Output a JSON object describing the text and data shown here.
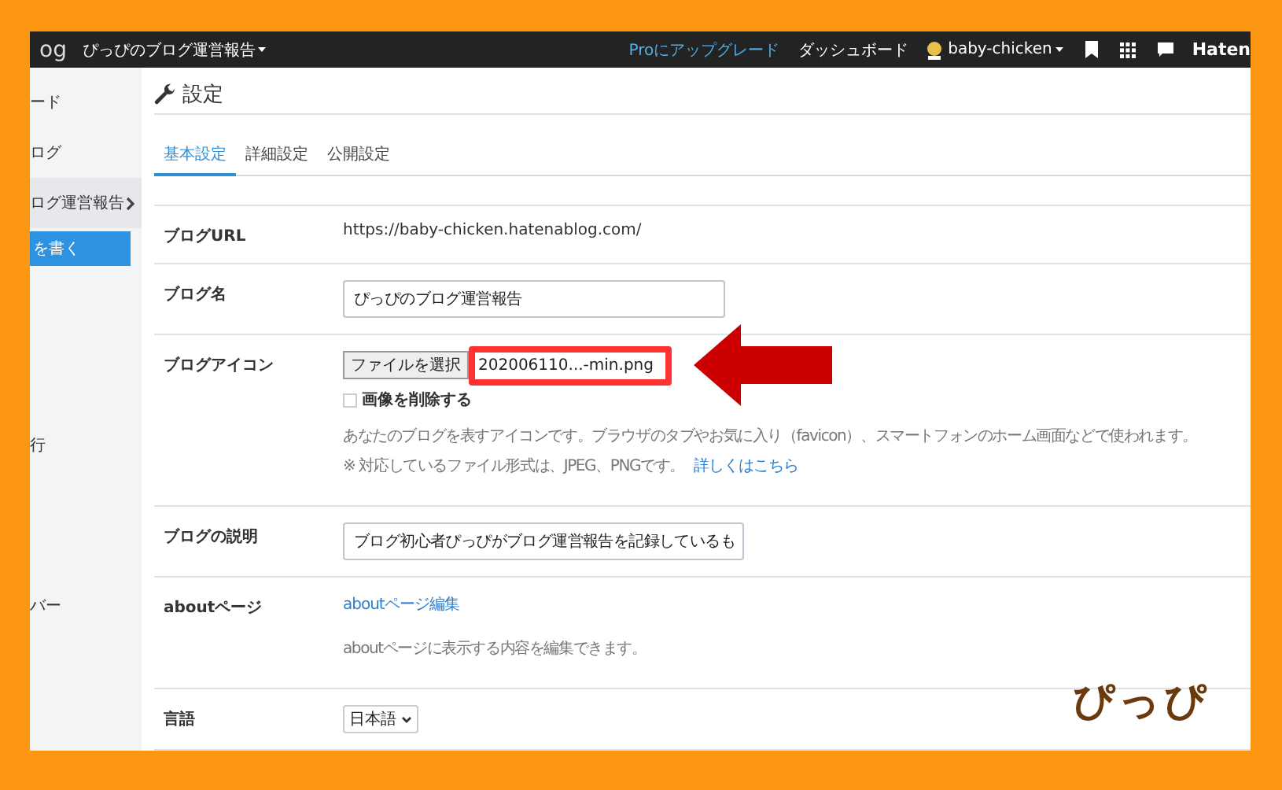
{
  "topbar": {
    "brand": "og",
    "blog_menu": "ぴっぴのブログ運営報告",
    "upgrade": "Proにアップグレード",
    "dashboard": "ダッシュボード",
    "user": "baby-chicken",
    "hatena": "Haten"
  },
  "sidebar": {
    "items": [
      {
        "kind": "link",
        "label": "ード",
        "selected": false
      },
      {
        "kind": "link",
        "label": "ログ",
        "selected": false
      },
      {
        "kind": "group",
        "label": "ログ運営報告",
        "selected": true
      },
      {
        "kind": "button",
        "label": "を書く",
        "selected": false
      },
      {
        "kind": "link",
        "label": "行",
        "selected": false
      },
      {
        "kind": "link",
        "label": "バー",
        "selected": false
      }
    ]
  },
  "heading": "設定",
  "tabs": [
    {
      "label": "基本設定",
      "selected": true
    },
    {
      "label": "詳細設定",
      "selected": false
    },
    {
      "label": "公開設定",
      "selected": false
    }
  ],
  "rows": [
    {
      "kind": "text",
      "label": "ブログURL",
      "value": "https://baby-chicken.hatenablog.com/"
    },
    {
      "kind": "input",
      "label": "ブログ名",
      "value": "ぴっぴのブログ運営報告"
    },
    {
      "kind": "file",
      "label": "ブログアイコン",
      "button": "ファイルを選択",
      "file": "202006110...-min.png",
      "checkbox": {
        "label": "画像を削除する",
        "checked": false
      },
      "help": "あなたのブログを表すアイコンです。ブラウザのタブやお気に入り（favicon）、スマートフォンのホーム画面などで使われます。",
      "note": "※ 対応しているファイル形式は、JPEG、PNGです。",
      "note_link": "詳しくはこちら"
    },
    {
      "kind": "input",
      "label": "ブログの説明",
      "value": "ブログ初心者ぴっぴがブログ運営報告を記録しているも"
    },
    {
      "kind": "link",
      "label": "aboutページ",
      "link": "aboutページ編集",
      "help": "aboutページに表示する内容を編集できます。"
    },
    {
      "kind": "select",
      "label": "言語",
      "value": "日本語"
    }
  ],
  "signature": "ぴっぴ"
}
